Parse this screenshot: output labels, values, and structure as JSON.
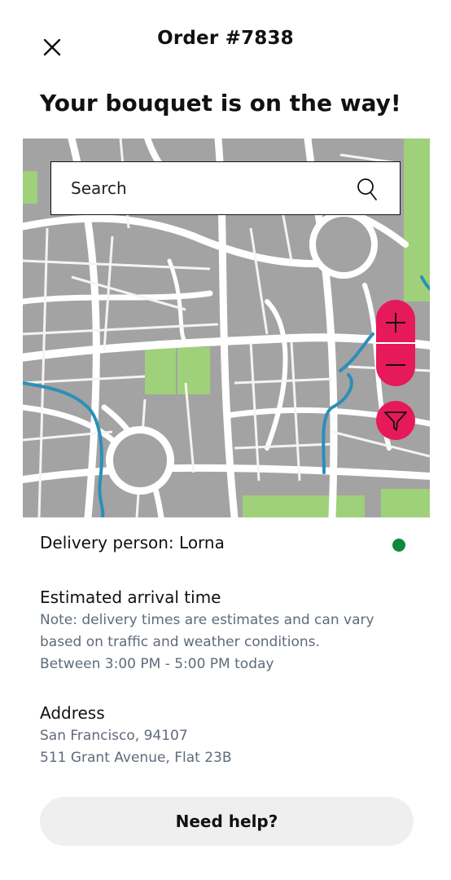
{
  "header": {
    "close_icon": "close-icon",
    "title": "Order #7838"
  },
  "heading": "Your bouquet is on the way!",
  "map": {
    "search_placeholder": "Search",
    "search_icon": "search-icon",
    "zoom_in_icon": "plus-icon",
    "zoom_out_icon": "minus-icon",
    "filter_icon": "filter-icon",
    "accent_color": "#e6195a",
    "park_color": "#9fd07a",
    "water_color": "#2b8fb8",
    "block_color": "#a3a3a3"
  },
  "delivery": {
    "label": "Delivery person: Lorna",
    "status_color": "#0c8a3c"
  },
  "arrival": {
    "title": "Estimated arrival time",
    "note_line1": "Note: delivery times are estimates and can vary",
    "note_line2": "based on traffic and weather conditions.",
    "window": "Between 3:00 PM - 5:00 PM today"
  },
  "address": {
    "title": "Address",
    "line1": "San Francisco, 94107",
    "line2": "511 Grant Avenue, Flat 23B"
  },
  "help_button": "Need help?"
}
